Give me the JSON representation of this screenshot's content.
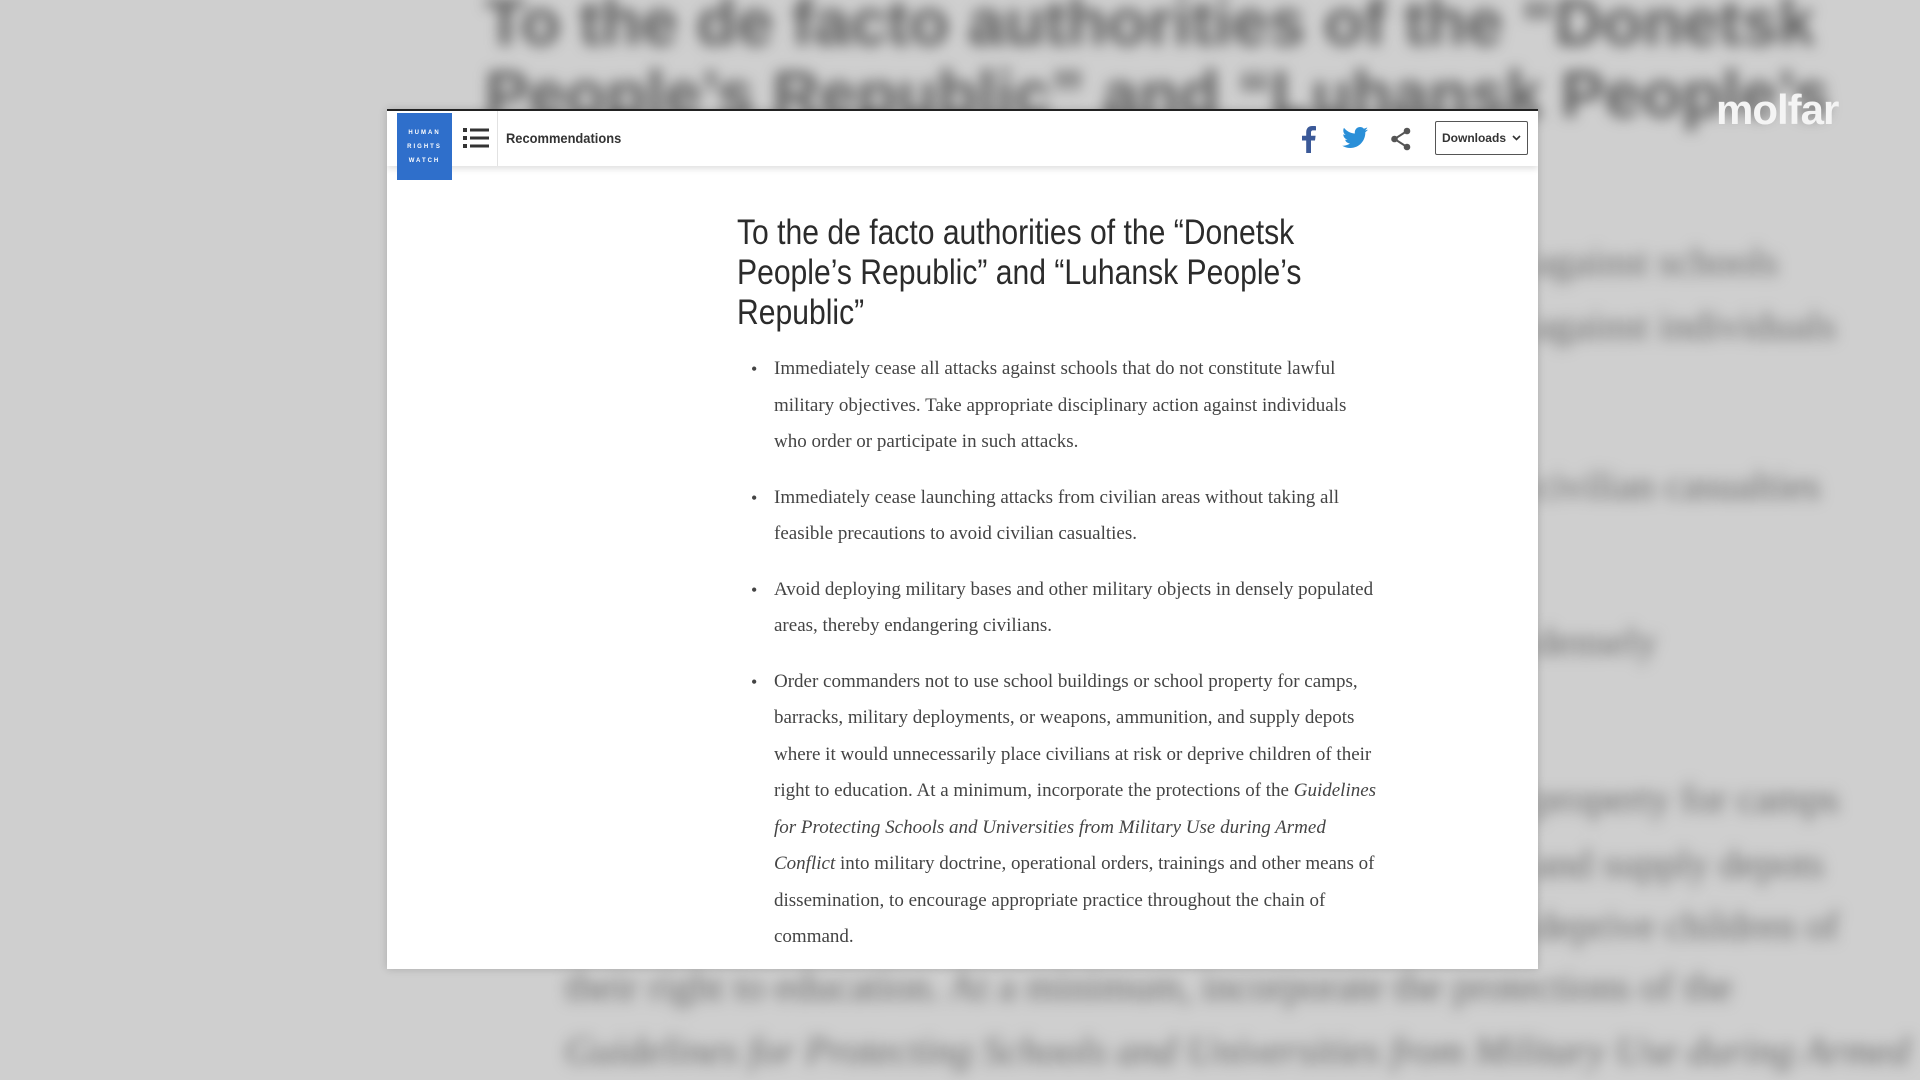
{
  "backdrop": {
    "title": "To the de facto authorities of the “Donetsk People’s Republic” and “Luhansk People’s",
    "lines": [
      "against schools",
      "against individuals",
      "civilian casualties",
      "densely",
      "property for camps",
      "and supply depots",
      "deprive children of",
      "their right to education. At a minimum, incorporate the protections of the",
      "Guidelines for Protecting Schools and Universities from Military Use during Armed"
    ]
  },
  "watermark": {
    "text": "molfar"
  },
  "header": {
    "logo_lines": [
      "HUMAN",
      "RIGHTS",
      "WATCH"
    ],
    "menu_icon": "list-menu-icon",
    "section_label": "Recommendations",
    "share": {
      "facebook_icon": "facebook-icon",
      "twitter_icon": "twitter-icon",
      "share_icon": "share-icon",
      "facebook_color": "#3b5998",
      "twitter_color": "#2a8fd8"
    },
    "downloads_label": "Downloads",
    "downloads_icon": "chevron-down-icon"
  },
  "content": {
    "heading": "To the de facto authorities of the “Donetsk People’s Republic” and “Luhansk People’s Republic”",
    "items": [
      {
        "text": "Immediately cease all attacks against schools that do not constitute lawful military objectives. Take appropriate disciplinary action against individuals who order or participate in such attacks."
      },
      {
        "text": "Immediately cease launching attacks from civilian areas without taking all feasible precautions to avoid civilian casualties."
      },
      {
        "text": "Avoid deploying military bases and other military objects in densely populated areas, thereby endangering civilians."
      },
      {
        "text_before": "Order commanders not to use school buildings or school property for camps, barracks, military deployments, or weapons, ammunition, and supply depots where it would unnecessarily place civilians at risk or deprive children of their right to education. At a minimum, incorporate the protections of the ",
        "italic": "Guidelines for Protecting Schools and Universities from Military Use during Armed Conflict",
        "text_after": " into military doctrine, operational orders, trainings and other means of dissemination, to encourage appropriate practice throughout the chain of command."
      }
    ]
  },
  "colors": {
    "brand_blue": "#2f6fcb",
    "text": "#444444",
    "heading": "#2b2b2b"
  }
}
